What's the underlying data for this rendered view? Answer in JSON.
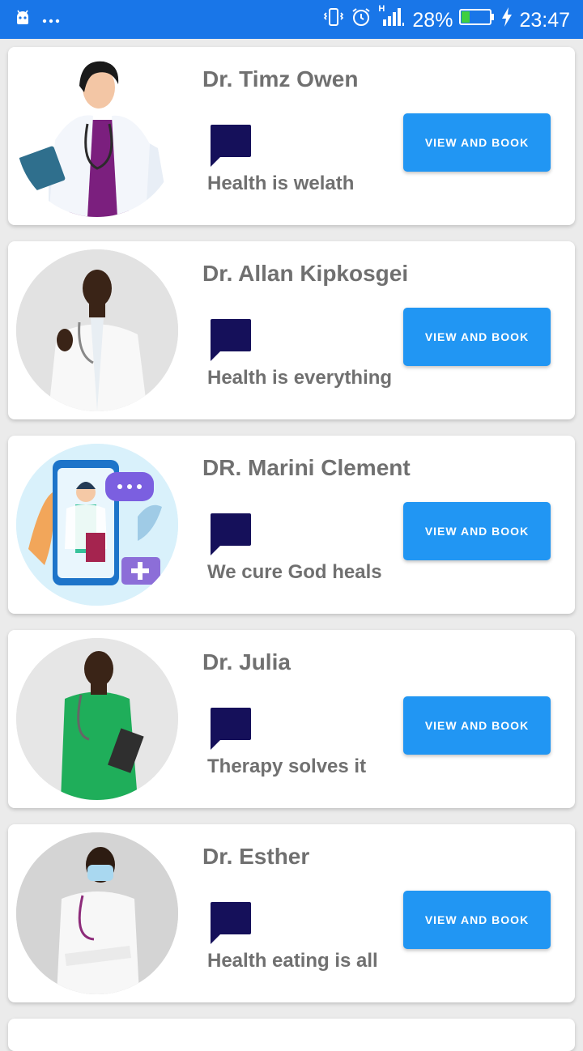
{
  "status_bar": {
    "battery": "28%",
    "time": "23:47",
    "network": "H",
    "icons": [
      "android-icon",
      "more-dots-icon",
      "vibrate-icon",
      "alarm-icon",
      "signal-icon",
      "battery-icon",
      "charging-icon"
    ]
  },
  "doctors": [
    {
      "name": "Dr. Timz Owen",
      "motto": "Health is welath",
      "button_label": "VIEW AND BOOK"
    },
    {
      "name": "Dr. Allan Kipkosgei",
      "motto": "Health is everything",
      "button_label": "VIEW AND BOOK"
    },
    {
      "name": "DR. Marini Clement",
      "motto": "We cure God heals",
      "button_label": "VIEW AND BOOK"
    },
    {
      "name": "Dr. Julia",
      "motto": "Therapy solves it",
      "button_label": "VIEW AND BOOK"
    },
    {
      "name": "Dr. Esther",
      "motto": "Health eating is all",
      "button_label": "VIEW AND BOOK"
    }
  ],
  "colors": {
    "status_bar": "#1976e8",
    "button": "#2196f3",
    "chat_icon": "#15105a",
    "text_gray": "#707070",
    "background": "#ebebeb"
  }
}
